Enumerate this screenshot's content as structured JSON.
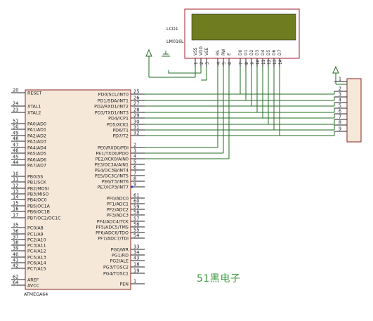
{
  "colors": {
    "background": "#ffffff",
    "body_fill": "#f6e8d8",
    "body_border": "#8b2323",
    "wire": "#1f6b1f",
    "pin_line": "#222222",
    "lcd_screen": "#6f7d20",
    "lcd_frame": "#a01e28",
    "power_arrow": "#2a6a2a",
    "watermark": "#3e9a3e",
    "pin_dot": "#2244cc"
  },
  "lcd": {
    "label": "LCD1",
    "model": "LM016L",
    "pin_names": [
      "VSS",
      "VDD",
      "VEE",
      "RS",
      "RW",
      "E",
      "D0",
      "D1",
      "D2",
      "D3",
      "D4",
      "D5",
      "D6",
      "D7"
    ],
    "pin_numbers": [
      "1",
      "2",
      "3",
      "4",
      "5",
      "6",
      "7",
      "8",
      "9",
      "10",
      "11",
      "12",
      "13",
      "14"
    ]
  },
  "mcu": {
    "part_name": "ATMEGA64",
    "left_pins": [
      {
        "num": "20",
        "name": "RESET"
      },
      {
        "num": "24",
        "name": "XTAL1"
      },
      {
        "num": "23",
        "name": "XTAL2"
      },
      {
        "num": "51",
        "name": "PA0/AD0"
      },
      {
        "num": "50",
        "name": "PA1/AD1"
      },
      {
        "num": "49",
        "name": "PA2/AD2"
      },
      {
        "num": "48",
        "name": "PA3/AD3"
      },
      {
        "num": "47",
        "name": "PA4/AD4"
      },
      {
        "num": "46",
        "name": "PA5/AD5"
      },
      {
        "num": "45",
        "name": "PA6/AD6"
      },
      {
        "num": "44",
        "name": "PA7/AD7"
      },
      {
        "num": "10",
        "name": "PB0/SS"
      },
      {
        "num": "11",
        "name": "PB1/SCK"
      },
      {
        "num": "12",
        "name": "PB2/MOSI"
      },
      {
        "num": "13",
        "name": "PB3/MISO"
      },
      {
        "num": "14",
        "name": "PB4/OC0"
      },
      {
        "num": "15",
        "name": "PB5/OC1A"
      },
      {
        "num": "16",
        "name": "PB6/OC1B"
      },
      {
        "num": "17",
        "name": "PB7/OC2/OC1C"
      },
      {
        "num": "35",
        "name": "PC0/A8"
      },
      {
        "num": "36",
        "name": "PC1/A9"
      },
      {
        "num": "37",
        "name": "PC2/A10"
      },
      {
        "num": "38",
        "name": "PC3/A11"
      },
      {
        "num": "39",
        "name": "PC4/A12"
      },
      {
        "num": "40",
        "name": "PC5/A13"
      },
      {
        "num": "41",
        "name": "PC6/A14"
      },
      {
        "num": "42",
        "name": "PC7/A15"
      },
      {
        "num": "62",
        "name": "AREF"
      },
      {
        "num": "64",
        "name": "AVCC"
      }
    ],
    "right_pins": [
      {
        "num": "25",
        "name": "PD0/SCL/INT0"
      },
      {
        "num": "26",
        "name": "PD1/SDA/INT1"
      },
      {
        "num": "27",
        "name": "PD2/RXD1/INT2"
      },
      {
        "num": "28",
        "name": "PD3/TXD1/INT3"
      },
      {
        "num": "29",
        "name": "PD4/ICP1"
      },
      {
        "num": "30",
        "name": "PD5/XCK1"
      },
      {
        "num": "31",
        "name": "PD6/T1"
      },
      {
        "num": "32",
        "name": "PD7/T2"
      },
      {
        "num": "2",
        "name": "PE0/RXD0/PDI"
      },
      {
        "num": "3",
        "name": "PE1/TXD0/PDO"
      },
      {
        "num": "4",
        "name": "PE2/XCK0/AIN0"
      },
      {
        "num": "5",
        "name": "PE3/OC3A/AIN1"
      },
      {
        "num": "6",
        "name": "PE4/OC3B/INT4"
      },
      {
        "num": "7",
        "name": "PE5/OC3C/INT5"
      },
      {
        "num": "8",
        "name": "PE6/T3/INT6"
      },
      {
        "num": "9",
        "name": "PE7/ICP3/INT7"
      },
      {
        "num": "61",
        "name": "PF0/ADC0"
      },
      {
        "num": "60",
        "name": "PF1/ADC1"
      },
      {
        "num": "59",
        "name": "PF2/ADC2"
      },
      {
        "num": "58",
        "name": "PF3/ADC3"
      },
      {
        "num": "57",
        "name": "PF4/ADC4/TCK"
      },
      {
        "num": "56",
        "name": "PF5/ADC5/TMS"
      },
      {
        "num": "55",
        "name": "PF6/ADC6/TDO"
      },
      {
        "num": "54",
        "name": "PF7/ADC7/TDI"
      },
      {
        "num": "33",
        "name": "PG0/WR"
      },
      {
        "num": "34",
        "name": "PG1/RD"
      },
      {
        "num": "43",
        "name": "PG2/ALE"
      },
      {
        "num": "18",
        "name": "PG3/TOSC2"
      },
      {
        "num": "19",
        "name": "PG4/TOSC1"
      },
      {
        "num": "1",
        "name": "PEN"
      }
    ]
  },
  "resistor_pack": {
    "pin_numbers": [
      "1",
      "2",
      "3",
      "4",
      "5",
      "6",
      "7",
      "8",
      "9"
    ]
  },
  "watermark": "51黑电子"
}
